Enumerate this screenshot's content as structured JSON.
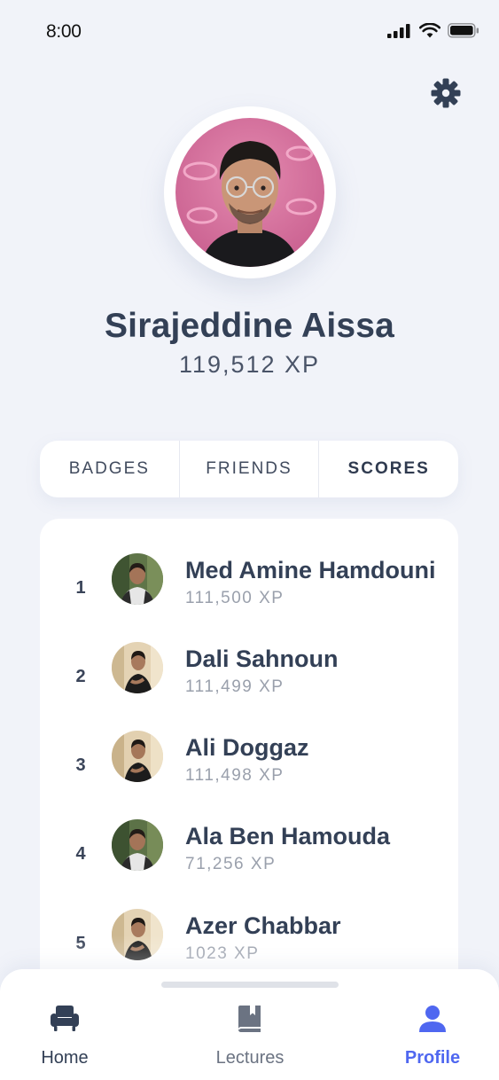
{
  "status": {
    "time": "8:00"
  },
  "profile": {
    "name": "Sirajeddine Aissa",
    "xp": "119,512 XP"
  },
  "tabs": [
    {
      "label": "BADGES",
      "active": false
    },
    {
      "label": "FRIENDS",
      "active": false
    },
    {
      "label": "SCORES",
      "active": true
    }
  ],
  "leaderboard": [
    {
      "rank": "1",
      "name": "Med Amine Hamdouni",
      "xp": "111,500 XP"
    },
    {
      "rank": "2",
      "name": "Dali Sahnoun",
      "xp": "111,499 XP"
    },
    {
      "rank": "3",
      "name": "Ali Doggaz",
      "xp": "111,498 XP"
    },
    {
      "rank": "4",
      "name": "Ala Ben Hamouda",
      "xp": "71,256 XP"
    },
    {
      "rank": "5",
      "name": "Azer Chabbar",
      "xp": "1023 XP"
    }
  ],
  "nav": {
    "home": "Home",
    "lectures": "Lectures",
    "profile": "Profile",
    "active": "profile"
  },
  "colors": {
    "accent": "#4f67f0",
    "text": "#334056",
    "muted": "#9aa0ac",
    "background": "#f1f3f9"
  },
  "icons": {
    "status": [
      "cellular-signal-icon",
      "wifi-icon",
      "battery-icon"
    ],
    "settings": "gear-icon",
    "nav": [
      "armchair-icon",
      "book-icon",
      "person-icon"
    ]
  }
}
